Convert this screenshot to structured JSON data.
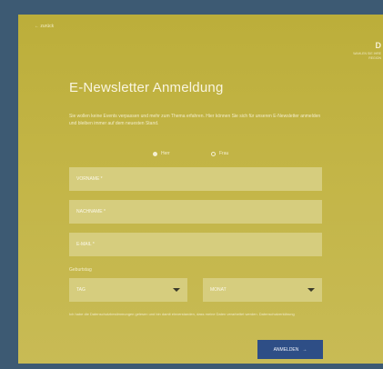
{
  "nav": {
    "back_label": "← zurück"
  },
  "side": {
    "mark": "D",
    "line1": "WAHLEN SIE IHRE",
    "line2": "REGION"
  },
  "form": {
    "title": "E-Newsletter Anmeldung",
    "intro": "Sie wollen keine Events verpassen und mehr zum Thema erfahren. Hier können Sie sich für unseren E-Newsletter anmelden und bleiben immer auf dem neuesten Stand.",
    "salutation": {
      "options": [
        "Herr",
        "Frau"
      ],
      "selected": "Herr"
    },
    "fields": {
      "first_name": "VORNAME *",
      "last_name": "NACHNAME *",
      "email": "E-MAIL *"
    },
    "dob_label": "Geburtstag",
    "day_select": "TAG",
    "month_select": "MONAT",
    "privacy": "Ich habe die Datenschutzbestimmungen gelesen und bin damit einverstanden, dass meine Daten verarbeitet werden. Datenschutzerklärung",
    "submit_label": "ANMELDEN",
    "submit_arrow": "→"
  },
  "colors": {
    "panel": "#c3b547",
    "field": "#d6cd7e",
    "button": "#2e4e86",
    "frame": "#3d5a73"
  }
}
